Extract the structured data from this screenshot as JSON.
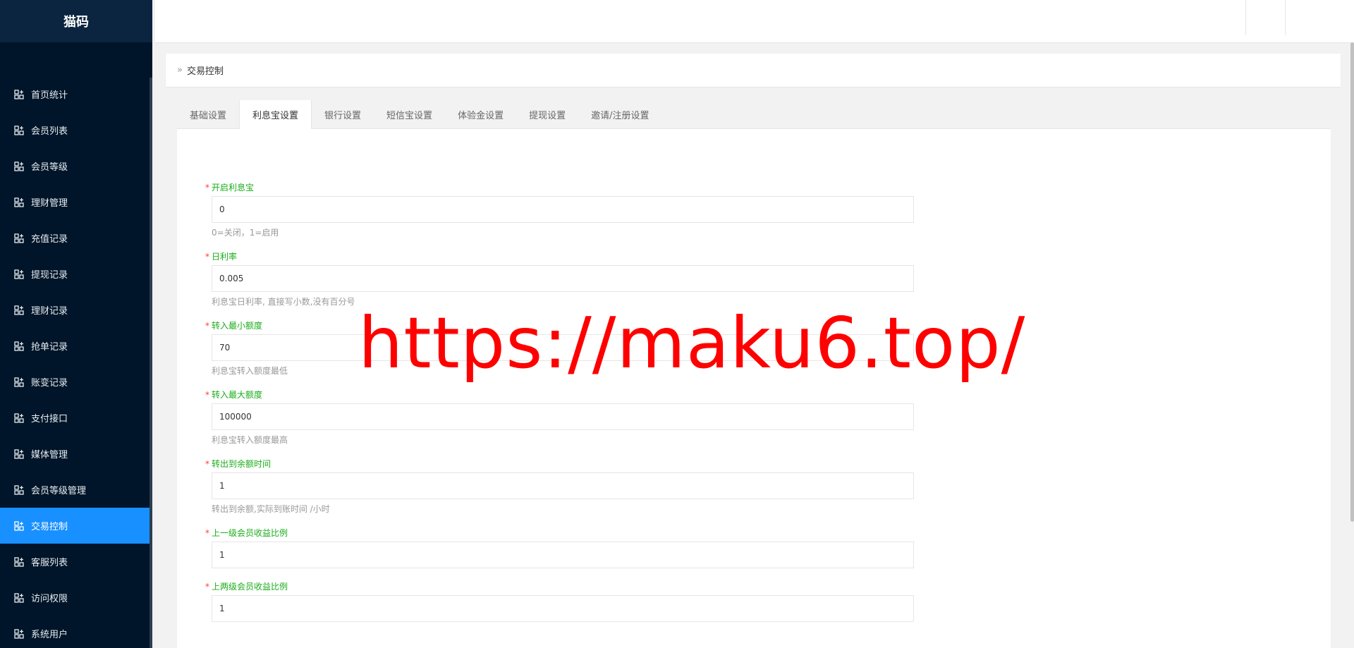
{
  "app": {
    "logo": "猫码"
  },
  "sidebar": {
    "items": [
      {
        "label": "首页统计"
      },
      {
        "label": "会员列表"
      },
      {
        "label": "会员等级"
      },
      {
        "label": "理财管理"
      },
      {
        "label": "充值记录"
      },
      {
        "label": "提现记录"
      },
      {
        "label": "理财记录"
      },
      {
        "label": "抢单记录"
      },
      {
        "label": "账变记录"
      },
      {
        "label": "支付接口"
      },
      {
        "label": "媒体管理"
      },
      {
        "label": "会员等级管理"
      },
      {
        "label": "交易控制",
        "active": true
      },
      {
        "label": "客服列表"
      },
      {
        "label": "访问权限"
      },
      {
        "label": "系统用户"
      }
    ]
  },
  "breadcrumb": {
    "current": "交易控制"
  },
  "tabs": [
    {
      "label": "基础设置"
    },
    {
      "label": "利息宝设置",
      "active": true
    },
    {
      "label": "银行设置"
    },
    {
      "label": "短信宝设置"
    },
    {
      "label": "体验金设置"
    },
    {
      "label": "提现设置"
    },
    {
      "label": "邀请/注册设置"
    }
  ],
  "form": {
    "fields": [
      {
        "label": "开启利息宝",
        "value": "0",
        "help": "0=关闭，1=启用"
      },
      {
        "label": "日利率",
        "value": "0.005",
        "help": "利息宝日利率, 直接写小数,没有百分号"
      },
      {
        "label": "转入最小额度",
        "value": "70",
        "help": "利息宝转入额度最低"
      },
      {
        "label": "转入最大额度",
        "value": "100000",
        "help": "利息宝转入额度最高"
      },
      {
        "label": "转出到余额时间",
        "value": "1",
        "help": "转出到余额,实际到账时间 /小时"
      },
      {
        "label": "上一级会员收益比例",
        "value": "1",
        "help": ""
      },
      {
        "label": "上两级会员收益比例",
        "value": "1",
        "help": ""
      }
    ]
  },
  "watermark": {
    "text": "https://maku6.top/"
  },
  "colors": {
    "sidebar_bg": "#001529",
    "active": "#1890ff",
    "label_green": "#1aad19",
    "required": "#ff3d3d",
    "watermark": "#ff0000"
  }
}
